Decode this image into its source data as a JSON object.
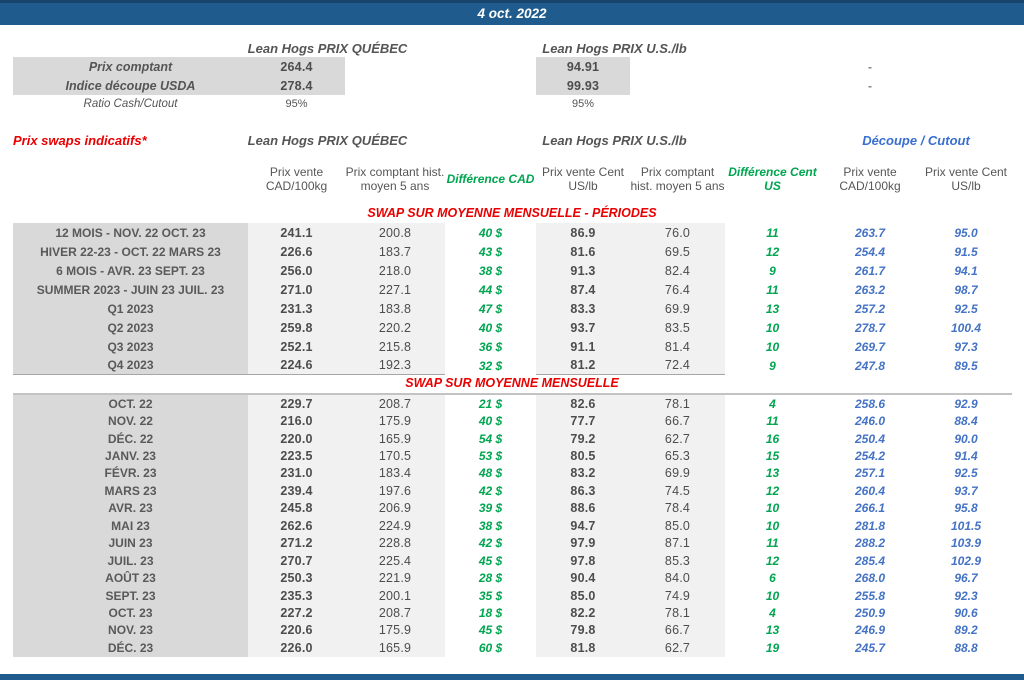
{
  "banner": {
    "date": "4 oct. 2022"
  },
  "colors": {
    "banner_blue": "#1f5c8d",
    "dark_edge_blue": "#17456b",
    "difference_green": "#00a550",
    "cutout_value_blue": "#4472c4",
    "cutout_header_blue": "#3a6fd0",
    "section_red": "#ea0000",
    "label_bg_gray": "#d9d9d9",
    "stripe_bg_gray": "#f1f1f1"
  },
  "spot": {
    "quebec_header": "Lean Hogs PRIX QUÉBEC",
    "us_header": "Lean Hogs PRIX U.S./lb",
    "rows": [
      {
        "label": "Prix comptant",
        "quebec": "264.4",
        "us": "94.91",
        "cutout": "-"
      },
      {
        "label": "Indice découpe USDA",
        "quebec": "278.4",
        "us": "99.93",
        "cutout": "-"
      },
      {
        "label": "Ratio Cash/Cutout",
        "quebec": "95%",
        "us": "95%",
        "cutout": ""
      }
    ]
  },
  "swaps": {
    "title": "Prix swaps indicatifs*",
    "group_headers": {
      "quebec": "Lean Hogs PRIX QUÉBEC",
      "us": "Lean Hogs PRIX U.S./lb",
      "cutout": "Découpe / Cutout"
    },
    "column_headers": [
      "Prix vente CAD/100kg",
      "Prix comptant hist. moyen 5 ans",
      "Différence CAD",
      "Prix vente Cent US/lb",
      "Prix comptant hist. moyen 5 ans",
      "Différence Cent US",
      "Prix vente CAD/100kg",
      "Prix vente Cent US/lb"
    ],
    "sections": [
      {
        "title": "SWAP SUR MOYENNE MENSUELLE - PÉRIODES",
        "rows": [
          {
            "label": "12 MOIS - NOV. 22 OCT. 23",
            "values": [
              "241.1",
              "200.8",
              "40 $",
              "86.9",
              "76.0",
              "11",
              "263.7",
              "95.0"
            ]
          },
          {
            "label": "HIVER 22-23 - OCT. 22 MARS 23",
            "values": [
              "226.6",
              "183.7",
              "43 $",
              "81.6",
              "69.5",
              "12",
              "254.4",
              "91.5"
            ]
          },
          {
            "label": "6 MOIS - AVR. 23 SEPT. 23",
            "values": [
              "256.0",
              "218.0",
              "38 $",
              "91.3",
              "82.4",
              "9",
              "261.7",
              "94.1"
            ]
          },
          {
            "label": "SUMMER 2023 - JUIN 23 JUIL. 23",
            "values": [
              "271.0",
              "227.1",
              "44 $",
              "87.4",
              "76.4",
              "11",
              "263.2",
              "98.7"
            ]
          },
          {
            "label": "Q1 2023",
            "values": [
              "231.3",
              "183.8",
              "47 $",
              "83.3",
              "69.9",
              "13",
              "257.2",
              "92.5"
            ]
          },
          {
            "label": "Q2 2023",
            "values": [
              "259.8",
              "220.2",
              "40 $",
              "93.7",
              "83.5",
              "10",
              "278.7",
              "100.4"
            ]
          },
          {
            "label": "Q3 2023",
            "values": [
              "252.1",
              "215.8",
              "36 $",
              "91.1",
              "81.4",
              "10",
              "269.7",
              "97.3"
            ]
          },
          {
            "label": "Q4 2023",
            "values": [
              "224.6",
              "192.3",
              "32 $",
              "81.2",
              "72.4",
              "9",
              "247.8",
              "89.5"
            ]
          }
        ]
      },
      {
        "title": "SWAP SUR MOYENNE MENSUELLE",
        "rows": [
          {
            "label": "OCT. 22",
            "values": [
              "229.7",
              "208.7",
              "21 $",
              "82.6",
              "78.1",
              "4",
              "258.6",
              "92.9"
            ]
          },
          {
            "label": "NOV. 22",
            "values": [
              "216.0",
              "175.9",
              "40 $",
              "77.7",
              "66.7",
              "11",
              "246.0",
              "88.4"
            ]
          },
          {
            "label": "DÉC. 22",
            "values": [
              "220.0",
              "165.9",
              "54 $",
              "79.2",
              "62.7",
              "16",
              "250.4",
              "90.0"
            ]
          },
          {
            "label": "JANV. 23",
            "values": [
              "223.5",
              "170.5",
              "53 $",
              "80.5",
              "65.3",
              "15",
              "254.2",
              "91.4"
            ]
          },
          {
            "label": "FÉVR. 23",
            "values": [
              "231.0",
              "183.4",
              "48 $",
              "83.2",
              "69.9",
              "13",
              "257.1",
              "92.5"
            ]
          },
          {
            "label": "MARS 23",
            "values": [
              "239.4",
              "197.6",
              "42 $",
              "86.3",
              "74.5",
              "12",
              "260.4",
              "93.7"
            ]
          },
          {
            "label": "AVR. 23",
            "values": [
              "245.8",
              "206.9",
              "39 $",
              "88.6",
              "78.4",
              "10",
              "266.1",
              "95.8"
            ]
          },
          {
            "label": "MAI 23",
            "values": [
              "262.6",
              "224.9",
              "38 $",
              "94.7",
              "85.0",
              "10",
              "281.8",
              "101.5"
            ]
          },
          {
            "label": "JUIN 23",
            "values": [
              "271.2",
              "228.8",
              "42 $",
              "97.9",
              "87.1",
              "11",
              "288.2",
              "103.9"
            ]
          },
          {
            "label": "JUIL. 23",
            "values": [
              "270.7",
              "225.4",
              "45 $",
              "97.8",
              "85.3",
              "12",
              "285.4",
              "102.9"
            ]
          },
          {
            "label": "AOÛT 23",
            "values": [
              "250.3",
              "221.9",
              "28 $",
              "90.4",
              "84.0",
              "6",
              "268.0",
              "96.7"
            ]
          },
          {
            "label": "SEPT. 23",
            "values": [
              "235.3",
              "200.1",
              "35 $",
              "85.0",
              "74.9",
              "10",
              "255.8",
              "92.3"
            ]
          },
          {
            "label": "OCT. 23",
            "values": [
              "227.2",
              "208.7",
              "18 $",
              "82.2",
              "78.1",
              "4",
              "250.9",
              "90.6"
            ]
          },
          {
            "label": "NOV. 23",
            "values": [
              "220.6",
              "175.9",
              "45 $",
              "79.8",
              "66.7",
              "13",
              "246.9",
              "89.2"
            ]
          },
          {
            "label": "DÉC. 23",
            "values": [
              "226.0",
              "165.9",
              "60 $",
              "81.8",
              "62.7",
              "19",
              "245.7",
              "88.8"
            ]
          }
        ]
      }
    ]
  }
}
